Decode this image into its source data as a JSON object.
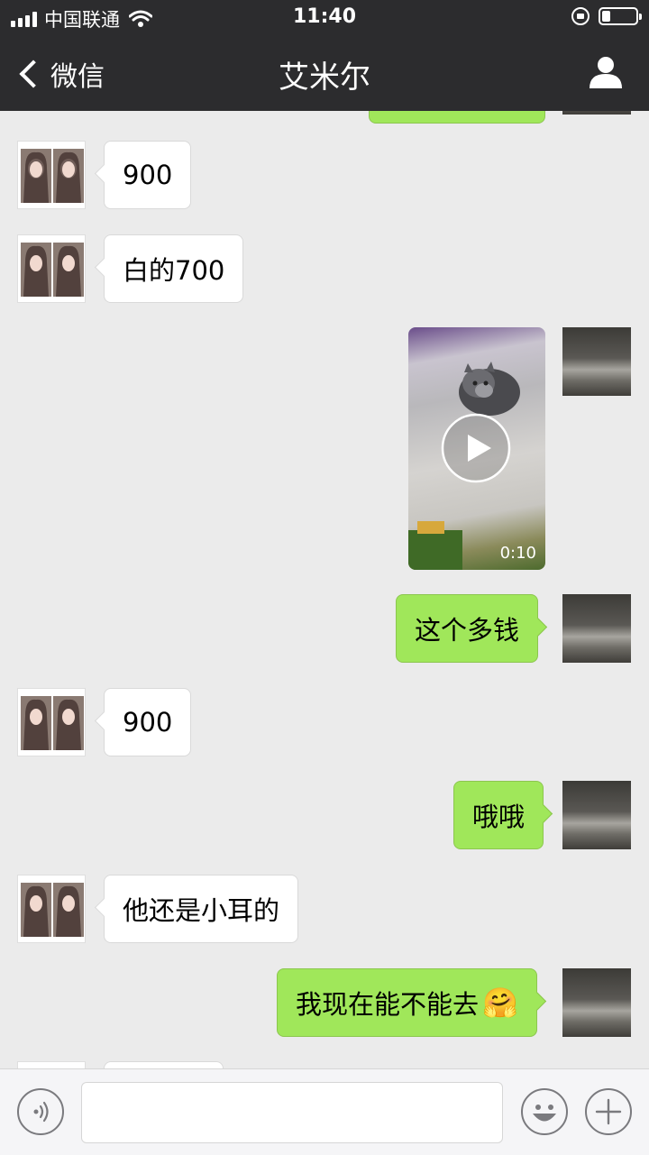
{
  "status_bar": {
    "carrier": "中国联通",
    "time": "11:40",
    "battery_level": 0.25,
    "icons": [
      "signal-icon",
      "wifi-icon",
      "rotation-lock-icon",
      "battery-icon"
    ]
  },
  "nav": {
    "back_label": "微信",
    "title": "艾米尔",
    "right_icon": "person-icon"
  },
  "messages": [
    {
      "side": "in",
      "text": "900"
    },
    {
      "side": "in",
      "text": "白的700"
    },
    {
      "side": "out",
      "type": "video",
      "duration": "0:10"
    },
    {
      "side": "out",
      "text": "这个多钱"
    },
    {
      "side": "in",
      "text": "900"
    },
    {
      "side": "out",
      "text": "哦哦"
    },
    {
      "side": "in",
      "text": "他还是小耳的"
    },
    {
      "side": "out",
      "text": "我现在能不能去",
      "emoji": "🤗"
    }
  ],
  "input_bar": {
    "left_icon": "voice-icon",
    "right_icons": [
      "emoji-icon",
      "plus-icon"
    ],
    "input_value": ""
  },
  "colors": {
    "header_bg": "#2c2c2e",
    "chat_bg": "#ebebeb",
    "outgoing_bubble": "#a0e75a",
    "incoming_bubble": "#ffffff"
  }
}
